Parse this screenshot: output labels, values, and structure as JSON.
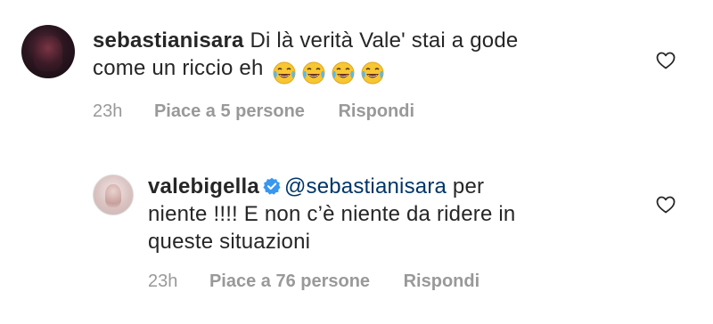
{
  "comments": [
    {
      "username": "sebastianisara",
      "text_line1": "Di là verità Vale' stai a gode",
      "text_line2": "come un riccio eh",
      "emojis": [
        "face-with-tears-of-joy",
        "face-with-tears-of-joy",
        "face-with-tears-of-joy",
        "face-with-tears-of-joy"
      ],
      "time": "23h",
      "likes": "Piace a 5 persone",
      "reply": "Rispondi"
    },
    {
      "username": "valebigella",
      "verified": true,
      "mention": "@sebastianisara",
      "text_rest1": " per",
      "text_line2": "niente !!!! E non c’è niente da ridere in",
      "text_line3": "queste situazioni",
      "time": "23h",
      "likes": "Piace a 76 persone",
      "reply": "Rispondi"
    }
  ],
  "colors": {
    "text": "#262626",
    "meta": "#999999",
    "mention": "#003569",
    "verified": "#3897f0"
  }
}
